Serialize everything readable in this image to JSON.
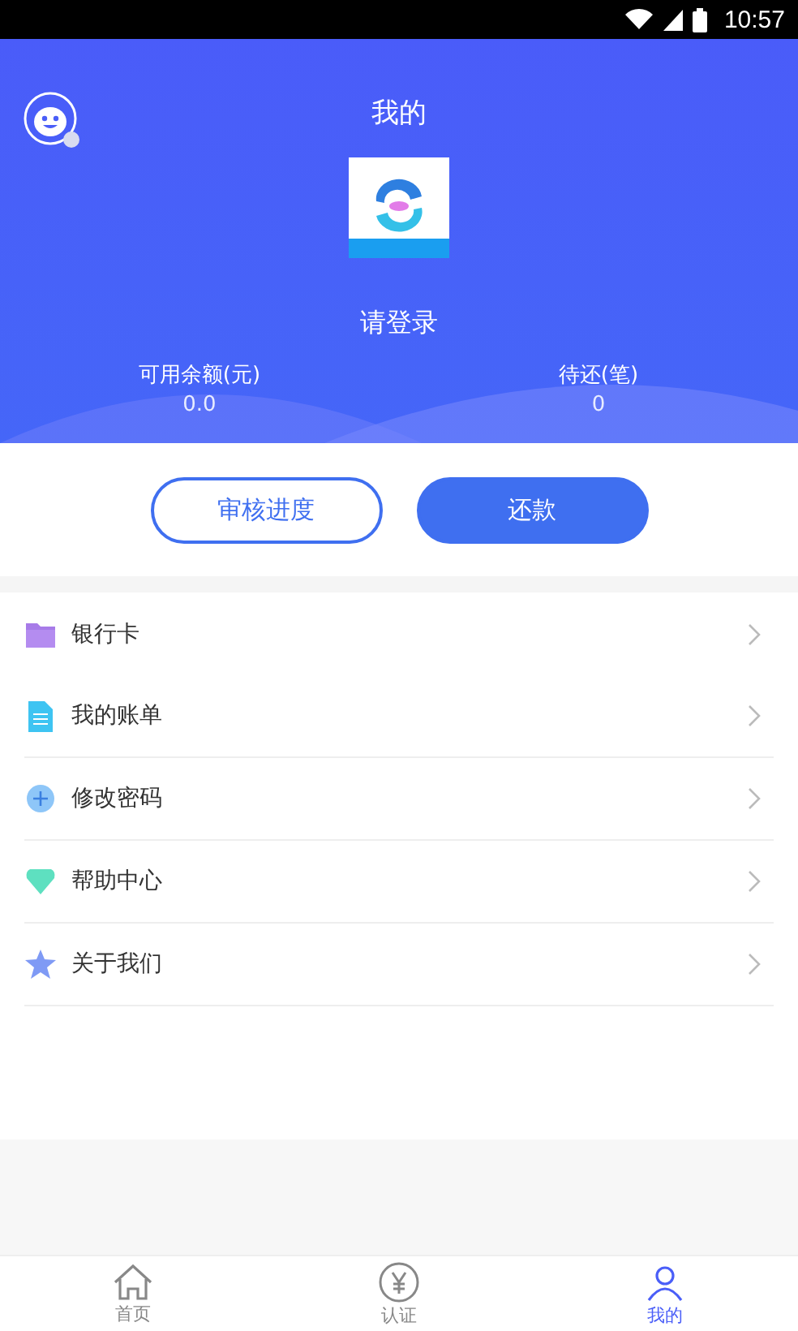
{
  "status_bar": {
    "time": "10:57"
  },
  "header": {
    "title": "我的",
    "login_prompt": "请登录",
    "stats": [
      {
        "label": "可用余额(元)",
        "value": "0.0"
      },
      {
        "label": "待还(笔)",
        "value": "0"
      }
    ]
  },
  "actions": [
    {
      "label": "审核进度",
      "kind": "outline"
    },
    {
      "label": "还款",
      "kind": "filled"
    }
  ],
  "menu": [
    {
      "label": "银行卡"
    },
    {
      "label": "我的账单"
    },
    {
      "label": "修改密码"
    },
    {
      "label": "帮助中心"
    },
    {
      "label": "关于我们"
    }
  ],
  "tabs": [
    {
      "label": "首页",
      "selected": false
    },
    {
      "label": "认证",
      "selected": false
    },
    {
      "label": "我的",
      "selected": true
    }
  ]
}
